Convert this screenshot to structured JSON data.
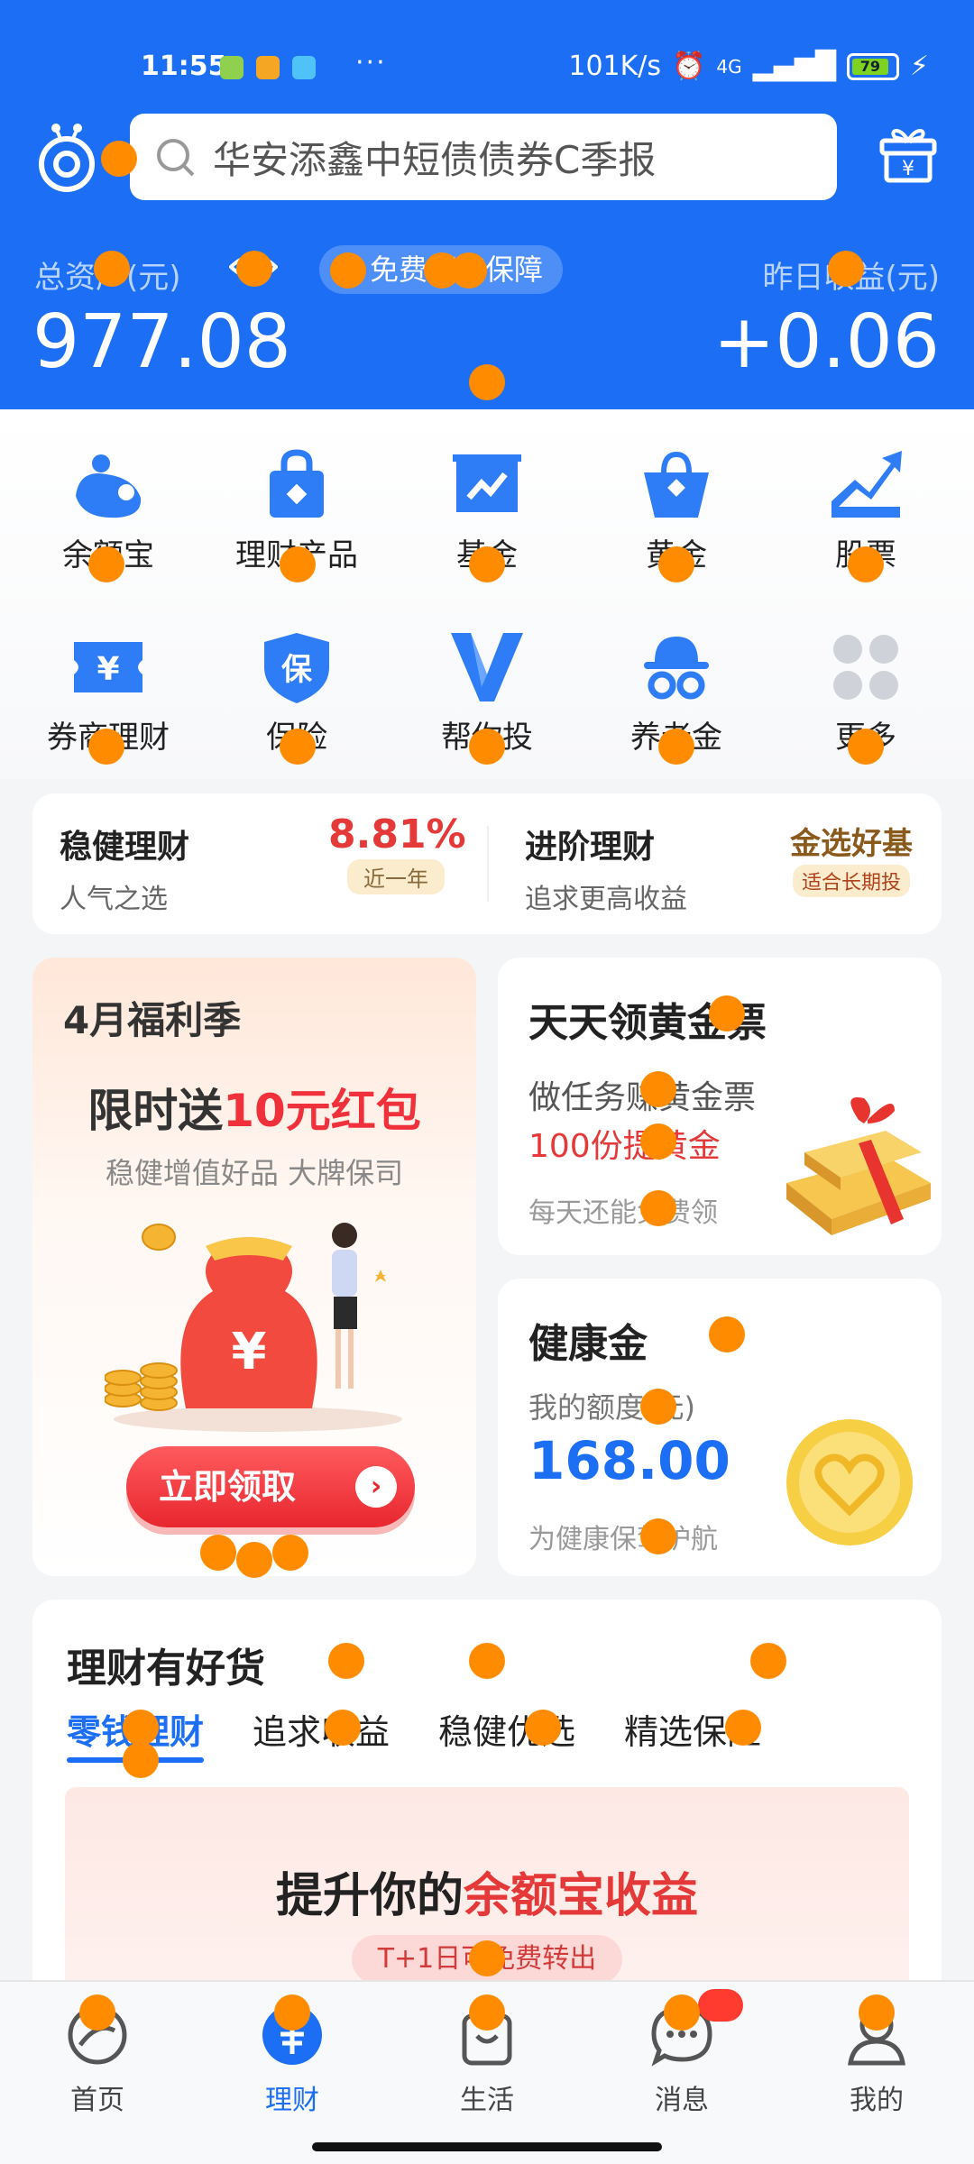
{
  "status_bar": {
    "time": "11:55",
    "dots": "···",
    "speed": "101K/s",
    "network": "4G",
    "battery": "79"
  },
  "search": {
    "placeholder": "华安添鑫中短债债券C季报"
  },
  "asset": {
    "label": "总资产(元)",
    "value": "977.08",
    "protect_label": "免费领取保障",
    "yesterday_label": "昨日收益(元)",
    "yesterday_value": "+0.06"
  },
  "grid": [
    {
      "label": "余额宝",
      "icon": "yuebao-icon"
    },
    {
      "label": "理财产品",
      "icon": "lock-bag-icon"
    },
    {
      "label": "基金",
      "icon": "fund-chart-icon"
    },
    {
      "label": "黄金",
      "icon": "gold-bag-icon"
    },
    {
      "label": "股票",
      "icon": "stock-trend-icon"
    },
    {
      "label": "券商理财",
      "icon": "ticket-yen-icon"
    },
    {
      "label": "保险",
      "icon": "shield-bao-icon"
    },
    {
      "label": "帮你投",
      "icon": "v-logo-icon"
    },
    {
      "label": "养老金",
      "icon": "hat-glasses-icon"
    },
    {
      "label": "更多",
      "icon": "more-dots-icon"
    }
  ],
  "strip": {
    "left_title": "稳健理财",
    "left_sub": "人气之选",
    "left_rate": "8.81%",
    "left_rate_label": "近一年",
    "right_title": "进阶理财",
    "right_sub": "追求更高收益",
    "right_badge": "金选好基",
    "right_badge_label": "适合长期投"
  },
  "promo": {
    "title": "4月福利季",
    "headline_a": "限时送",
    "headline_b": "10元红包",
    "sub": "稳健增值好品 大牌保司",
    "cta": "立即领取",
    "cta_arrow": "›"
  },
  "gold": {
    "title": "天天领黄金票",
    "line1": "做任务赚黄金票",
    "line2": "100份提黄金",
    "line3": "每天还能免费领"
  },
  "health": {
    "title": "健康金",
    "line1": "我的额度(元)",
    "amount": "168.00",
    "line3": "为健康保驾护航"
  },
  "goods": {
    "title": "理财有好货",
    "tabs": [
      "零钱理财",
      "追求收益",
      "稳健优选",
      "精选保险"
    ],
    "panel_a": "提升你的",
    "panel_b": "余额宝收益",
    "pill": "T+1日可免费转出"
  },
  "nav": [
    {
      "label": "首页",
      "icon": "home-icon"
    },
    {
      "label": "理财",
      "icon": "wealth-icon"
    },
    {
      "label": "生活",
      "icon": "life-bag-icon"
    },
    {
      "label": "消息",
      "icon": "message-icon"
    },
    {
      "label": "我的",
      "icon": "profile-icon"
    }
  ],
  "colors": {
    "brand_blue": "#1c6ff5",
    "accent_red": "#e53838",
    "overlay_orange": "#ff8c00"
  }
}
